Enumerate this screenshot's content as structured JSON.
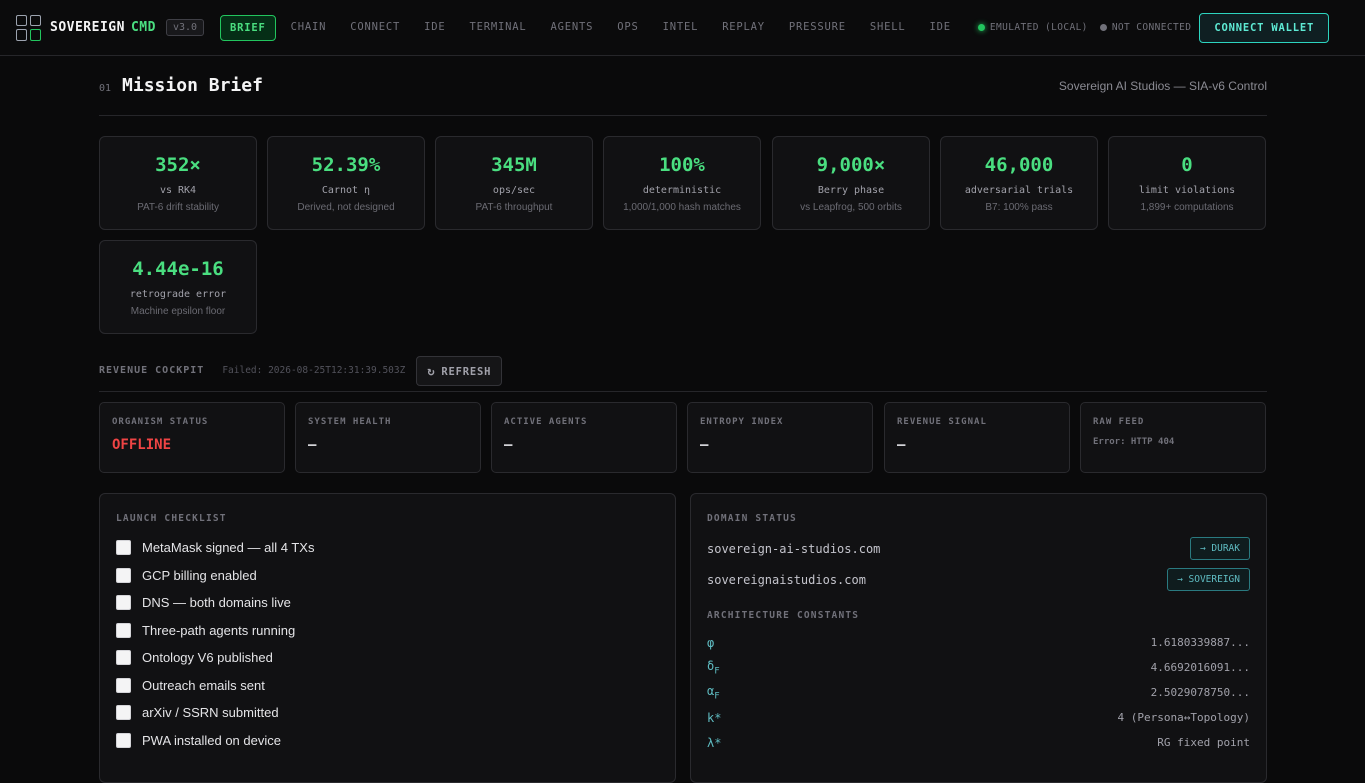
{
  "brand": {
    "name": "SOVEREIGN",
    "suffix": "CMD",
    "version": "v3.0"
  },
  "nav": [
    "BRIEF",
    "CHAIN",
    "CONNECT",
    "IDE",
    "TERMINAL",
    "AGENTS",
    "OPS",
    "INTEL",
    "REPLAY",
    "PRESSURE",
    "SHELL",
    "IDE"
  ],
  "nav_active": "BRIEF",
  "status": {
    "emulated": "EMULATED (LOCAL)",
    "connection": "NOT CONNECTED",
    "wallet_button": "CONNECT WALLET"
  },
  "colors": {
    "accent": "#4ade80",
    "offline": "#ef4444",
    "teal": "#5eead4"
  },
  "section": {
    "number": "01",
    "title": "Mission Brief",
    "subtitle": "Sovereign AI Studios — SIA-v6 Control"
  },
  "metrics": [
    {
      "value": "352×",
      "label": "vs RK4",
      "sub": "PAT-6 drift stability"
    },
    {
      "value": "52.39%",
      "label": "Carnot η",
      "sub": "Derived, not designed"
    },
    {
      "value": "345M",
      "label": "ops/sec",
      "sub": "PAT-6 throughput"
    },
    {
      "value": "100%",
      "label": "deterministic",
      "sub": "1,000/1,000 hash matches"
    },
    {
      "value": "9,000×",
      "label": "Berry phase",
      "sub": "vs Leapfrog, 500 orbits"
    },
    {
      "value": "46,000",
      "label": "adversarial trials",
      "sub": "B7: 100% pass"
    },
    {
      "value": "0",
      "label": "limit violations",
      "sub": "1,899+ computations"
    },
    {
      "value": "4.44e-16",
      "label": "retrograde error",
      "sub": "Machine epsilon floor"
    }
  ],
  "revenue": {
    "label": "REVENUE COCKPIT",
    "failed": "Failed: 2026-08-25T12:31:39.503Z",
    "refresh": "REFRESH"
  },
  "status_cards": [
    {
      "label": "ORGANISM STATUS",
      "value": "OFFLINE"
    },
    {
      "label": "SYSTEM HEALTH",
      "value": "—"
    },
    {
      "label": "ACTIVE AGENTS",
      "value": "—"
    },
    {
      "label": "ENTROPY INDEX",
      "value": "—"
    },
    {
      "label": "REVENUE SIGNAL",
      "value": "—"
    },
    {
      "label": "RAW FEED",
      "value": "Error: HTTP 404"
    }
  ],
  "checklist": {
    "title": "LAUNCH CHECKLIST",
    "items": [
      "MetaMask signed — all 4 TXs",
      "GCP billing enabled",
      "DNS — both domains live",
      "Three-path agents running",
      "Ontology V6 published",
      "Outreach emails sent",
      "arXiv / SSRN submitted",
      "PWA installed on device"
    ]
  },
  "domains": {
    "title": "DOMAIN STATUS",
    "items": [
      {
        "name": "sovereign-ai-studios.com",
        "target": "→ DURAK"
      },
      {
        "name": "sovereignaistudios.com",
        "target": "→ SOVEREIGN"
      }
    ]
  },
  "constants": {
    "title": "ARCHITECTURE CONSTANTS",
    "items": [
      {
        "symbol": "φ",
        "value": "1.6180339887..."
      },
      {
        "symbol": "δF",
        "value": "4.6692016091..."
      },
      {
        "symbol": "αF",
        "value": "2.5029078750..."
      },
      {
        "symbol": "k*",
        "value": "4 (Persona↔Topology)"
      },
      {
        "symbol": "λ*",
        "value": "RG fixed point"
      }
    ]
  }
}
